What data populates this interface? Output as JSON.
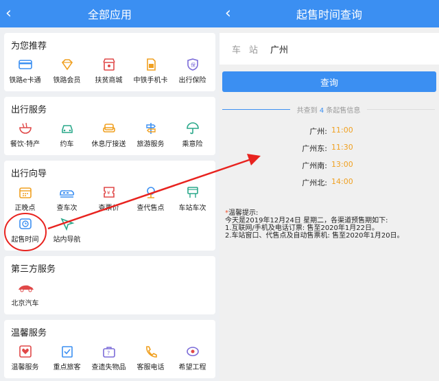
{
  "left": {
    "title": "全部应用",
    "back": "‹",
    "sections": [
      {
        "title": "为您推荐",
        "items": [
          {
            "label": "铁路e卡通",
            "icon": "card-icon"
          },
          {
            "label": "铁路会员",
            "icon": "diamond-icon"
          },
          {
            "label": "扶贫商城",
            "icon": "shop-icon"
          },
          {
            "label": "中铁手机卡",
            "icon": "simcard-icon"
          },
          {
            "label": "出行保险",
            "icon": "insurance-icon"
          }
        ]
      },
      {
        "title": "出行服务",
        "items": [
          {
            "label": "餐饮·特产",
            "icon": "noodle-icon"
          },
          {
            "label": "约车",
            "icon": "car-icon"
          },
          {
            "label": "休息厅接送",
            "icon": "sofa-icon"
          },
          {
            "label": "旅游服务",
            "icon": "signpost-icon"
          },
          {
            "label": "乘意险",
            "icon": "umbrella-icon"
          }
        ]
      },
      {
        "title": "出行向导",
        "items": [
          {
            "label": "正晚点",
            "icon": "calendar-icon"
          },
          {
            "label": "查车次",
            "icon": "train-icon"
          },
          {
            "label": "查票价",
            "icon": "ticket-icon"
          },
          {
            "label": "查代售点",
            "icon": "location-icon"
          },
          {
            "label": "车站车次",
            "icon": "station-icon"
          },
          {
            "label": "起售时间",
            "icon": "clock-icon"
          },
          {
            "label": "站内导航",
            "icon": "navigation-icon"
          }
        ]
      },
      {
        "title": "第三方服务",
        "items": [
          {
            "label": "北京汽车",
            "icon": "bjcar-icon"
          }
        ]
      },
      {
        "title": "温馨服务",
        "items": [
          {
            "label": "温馨服务",
            "icon": "heart-icon"
          },
          {
            "label": "重点旅客",
            "icon": "checklist-icon"
          },
          {
            "label": "查遗失物品",
            "icon": "bag-icon"
          },
          {
            "label": "客服电话",
            "icon": "phone-icon"
          },
          {
            "label": "希望工程",
            "icon": "hope-icon"
          }
        ]
      }
    ]
  },
  "right": {
    "title": "起售时间查询",
    "back": "‹",
    "station_label": "车站",
    "station_value": "广州",
    "query_button": "查询",
    "result_prefix": "共查到 ",
    "result_count": "4",
    "result_suffix": " 条起售信息",
    "results": [
      {
        "station": "广州:",
        "time": "11:00"
      },
      {
        "station": "广州东:",
        "time": "11:30"
      },
      {
        "station": "广州南:",
        "time": "13:00"
      },
      {
        "station": "广州北:",
        "time": "14:00"
      }
    ],
    "tips_title": "温馨提示:",
    "tips_lines": [
      "今天是2019年12月24日 星期二，各渠道预售期如下:",
      "1.互联网/手机及电话订票: 售至2020年1月22日。",
      "2.车站窗口、代售点及自动售票机: 售至2020年1月20日。"
    ]
  },
  "colors": {
    "accent": "#3b8ff2",
    "icon_orange": "#f0a020",
    "icon_red": "#e04848",
    "annotation_red": "#e8231f"
  }
}
